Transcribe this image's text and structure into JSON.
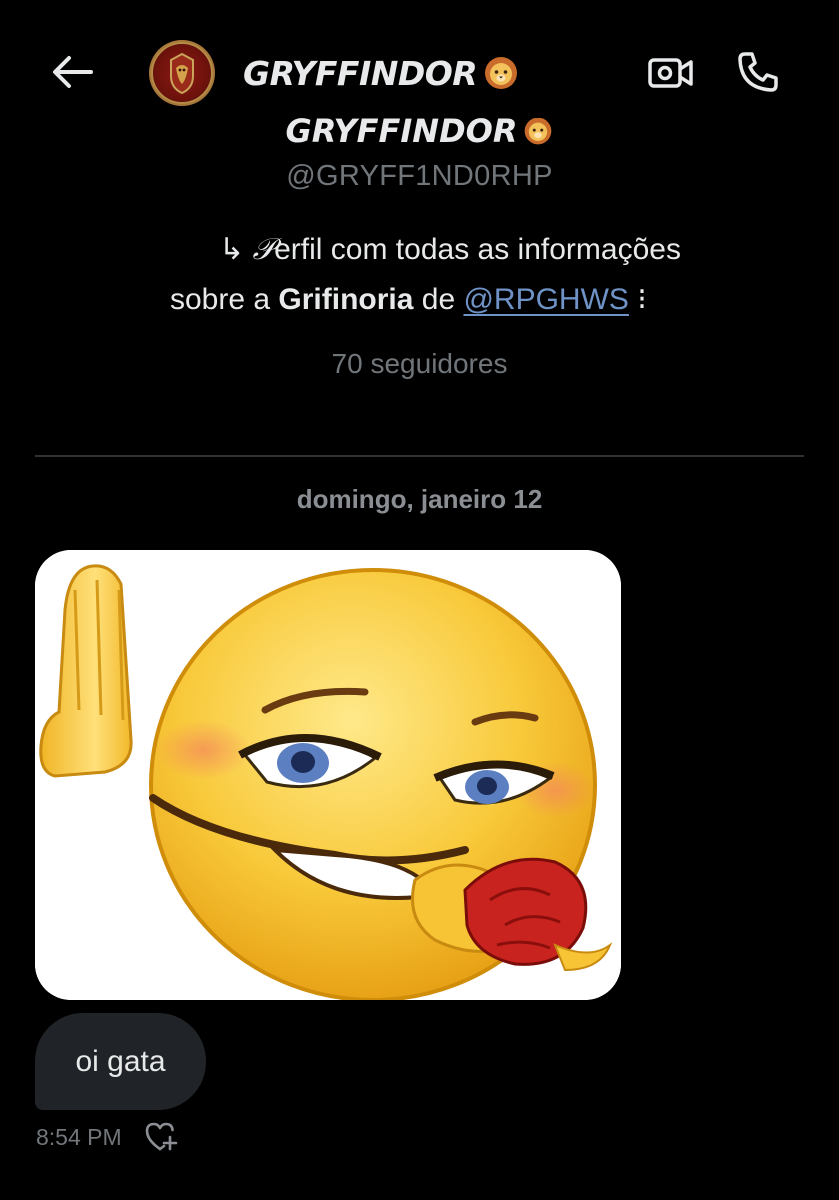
{
  "header": {
    "title": "GRYFFINDOR",
    "title_emoji": "lion-face",
    "icons": [
      "back-arrow-icon",
      "video-camera-icon",
      "phone-icon"
    ]
  },
  "profile": {
    "name": "GRYFFINDOR",
    "handle": "@GRYFF1ND0RHP",
    "bio": {
      "arrow": "↳",
      "script_letter": "𝒫",
      "line1_rest": "erfil com todas as informações",
      "line2_prefix": "sobre a ",
      "line2_bold": "Grifinoria",
      "line2_mid": " de ",
      "line2_link": "@RPGHWS",
      "line2_suffix": " ⁝"
    },
    "followers": "70 seguidores"
  },
  "conversation": {
    "date_separator": "domingo, janeiro 12",
    "messages": [
      {
        "type": "image",
        "content": "emoji-meme-image"
      },
      {
        "type": "text",
        "text": "oi gata"
      }
    ],
    "timestamp": "8:54 PM"
  },
  "colors": {
    "background": "#000000",
    "text_primary": "#e7e9ea",
    "text_secondary": "#71767b",
    "link": "#6f93c6",
    "bubble": "#202327",
    "divider": "#2f3336"
  }
}
